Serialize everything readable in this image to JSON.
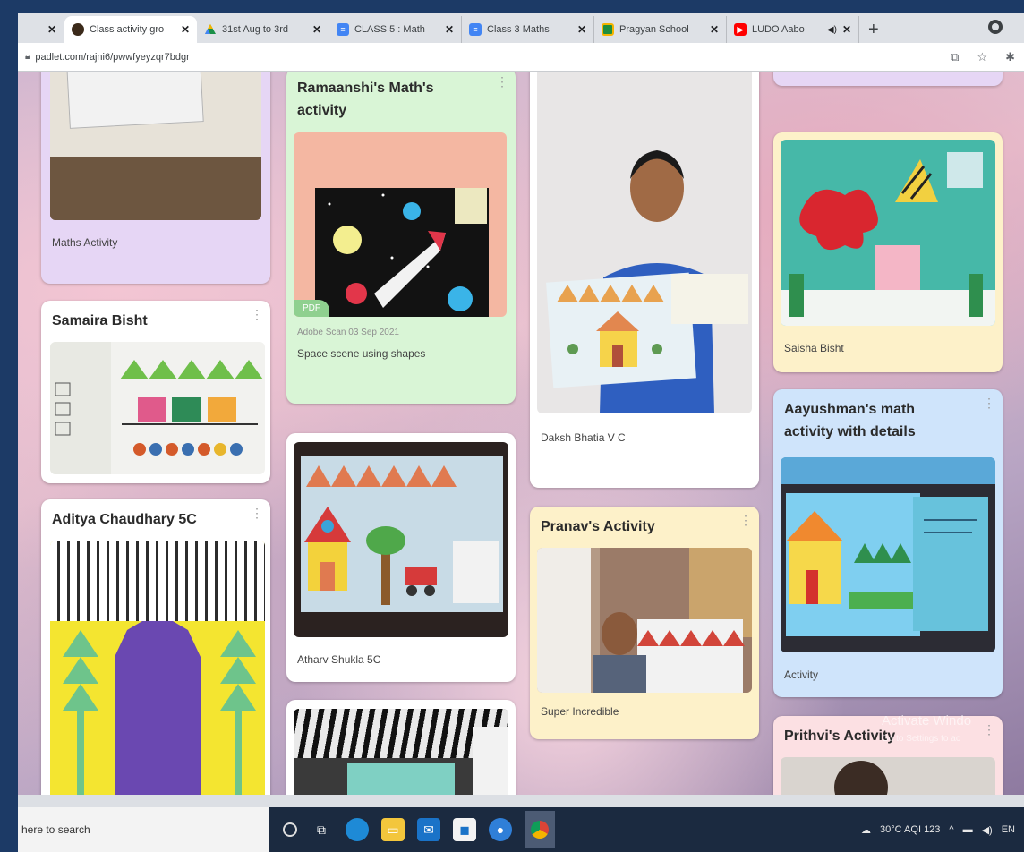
{
  "browser": {
    "tabs": [
      {
        "title": "",
        "favicon": "partial-tab-icon",
        "color": "#5f6368",
        "active": false
      },
      {
        "title": "Class activity gro",
        "favicon": "padlet-icon",
        "color": "#3b2a1a",
        "active": true
      },
      {
        "title": "31st Aug to 3rd",
        "favicon": "drive-icon",
        "color": "#1a8f47",
        "active": false
      },
      {
        "title": "CLASS 5 : Math",
        "favicon": "forms-icon",
        "color": "#4285f4",
        "active": false
      },
      {
        "title": "Class 3 Maths",
        "favicon": "forms-icon",
        "color": "#4285f4",
        "active": false
      },
      {
        "title": "Pragyan School",
        "favicon": "classroom-icon",
        "color": "#1e8e3e",
        "active": false
      },
      {
        "title": "LUDO Aabo",
        "favicon": "youtube-icon",
        "color": "#ff0000",
        "active": false
      }
    ],
    "new_tab_label": "+",
    "url": "padlet.com/rajni6/pwwfyeyzqr7bdgr"
  },
  "padlet": {
    "cards": [
      {
        "id": "maths-activity",
        "title": "",
        "caption": "Maths Activity",
        "bg": "#e6d6f5"
      },
      {
        "id": "samaira",
        "title": "Samaira Bisht",
        "caption": "",
        "bg": "#ffffff"
      },
      {
        "id": "aditya",
        "title": "Aditya Chaudhary 5C",
        "caption": "",
        "bg": "#ffffff"
      },
      {
        "id": "ramaanshi",
        "title": "Ramaanshi's Math's activity",
        "caption": "Space scene using shapes",
        "meta": "Adobe Scan 03 Sep 2021",
        "badge": "PDF",
        "bg": "#d9f5d6"
      },
      {
        "id": "atharv",
        "title": "",
        "caption": "Atharv Shukla 5C",
        "bg": "#ffffff"
      },
      {
        "id": "daksh",
        "title": "",
        "caption": "Daksh Bhatia V C",
        "bg": "#ffffff"
      },
      {
        "id": "pranav",
        "title": "Pranav's Activity",
        "caption": "Super Incredible",
        "bg": "#fdf1c9"
      },
      {
        "id": "saisha",
        "title": "",
        "caption": "Saisha Bisht",
        "bg": "#fdf1c9"
      },
      {
        "id": "aayushman",
        "title": "Aayushman's math activity with details",
        "caption": "Activity",
        "bg": "#cfe4fb"
      },
      {
        "id": "prithvi",
        "title": "Prithvi's Activity",
        "caption": "",
        "bg": "#fce0e3"
      }
    ]
  },
  "watermark": {
    "line1": "Activate Windo",
    "line2": "Go to Settings to ac"
  },
  "taskbar": {
    "search_placeholder": "here to search",
    "weather": "30°C  AQI 123",
    "lang": "EN"
  }
}
